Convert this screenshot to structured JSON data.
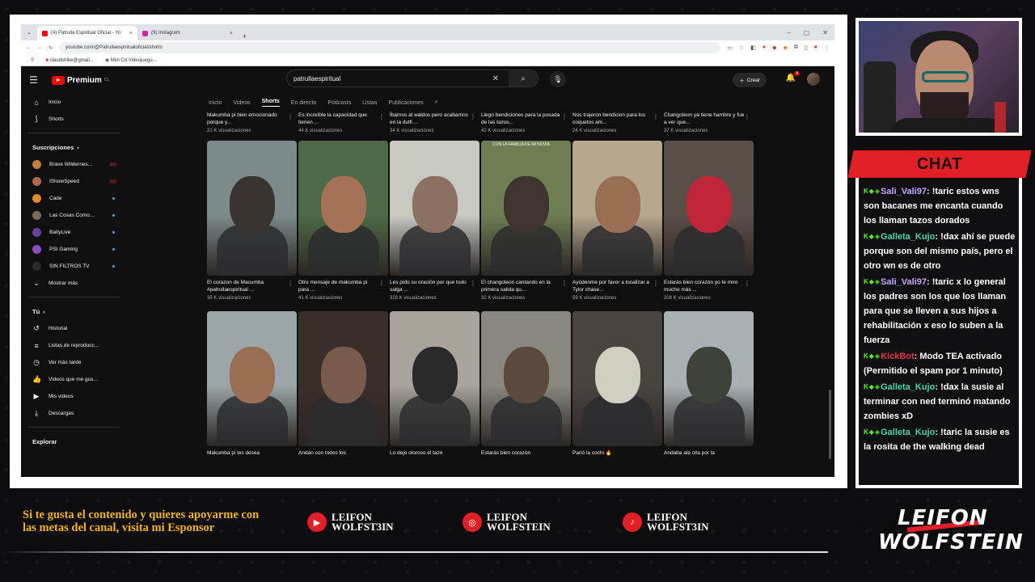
{
  "browser": {
    "tabs": [
      {
        "label": "(4) Patrulla Espiritual Oficial - Yo",
        "favicon_color": "#ff0000"
      },
      {
        "label": "(9) Instagram",
        "favicon_color": "#d6249f"
      }
    ],
    "url": "youtube.com/@Patrullaespiritualoficial/shorts",
    "bookmarks": [
      "claudstrike@gmail...",
      "Mini Cd Videojuego..."
    ]
  },
  "youtube": {
    "logo": "Premium",
    "logo_sup": "CL",
    "search_value": "patrullaespiritual",
    "create_label": "Crear",
    "notif_count": "4",
    "sidebar": {
      "main": [
        {
          "label": "Inicio",
          "icon": "home-icon"
        },
        {
          "label": "Shorts",
          "icon": "shorts-icon"
        }
      ],
      "subs_header": "Suscripciones",
      "subs": [
        {
          "label": "Brave Wildernes...",
          "color": "#c0803a",
          "live": true
        },
        {
          "label": "IShowSpeed",
          "color": "#b5674f",
          "live": true
        },
        {
          "label": "Cade",
          "color": "#e08a2a",
          "dot": true
        },
        {
          "label": "Las Cosas Como...",
          "color": "#7a6a5a",
          "dot": true
        },
        {
          "label": "BaityLive",
          "color": "#6a3f9a",
          "dot": true
        },
        {
          "label": "PSI Gaming",
          "color": "#8a4cc0",
          "dot": true
        },
        {
          "label": "SIN FILTROS TV",
          "color": "#2a2a2a",
          "dot": true
        }
      ],
      "more": "Mostrar más",
      "you_header": "Tú",
      "you": [
        {
          "label": "Historial",
          "icon": "history-icon"
        },
        {
          "label": "Listas de reproducc...",
          "icon": "playlist-icon"
        },
        {
          "label": "Ver más tarde",
          "icon": "clock-icon"
        },
        {
          "label": "Videos que me gus...",
          "icon": "like-icon"
        },
        {
          "label": "Mis videos",
          "icon": "video-icon"
        },
        {
          "label": "Descargas",
          "icon": "download-icon"
        }
      ],
      "explore_header": "Explorar"
    },
    "tabs": [
      "Inicio",
      "Videos",
      "Shorts",
      "En directo",
      "Pódcasts",
      "Listas",
      "Publicaciones"
    ],
    "active_tab": "Shorts",
    "row1": [
      {
        "title": "Makumba pi bien emocionado porque y...",
        "views": "21 K visualizaciones"
      },
      {
        "title": "Es increíble la capacidad que tienen ...",
        "views": "44 K visualizaciones"
      },
      {
        "title": "Íbamos al waldos pero acabamos en la dulfi ...",
        "views": "34 K visualizaciones"
      },
      {
        "title": "Llego bendiciones para la posada de las tazos...",
        "views": "42 K visualizaciones"
      },
      {
        "title": "Nos trajeron bendicion para los coquetos am...",
        "views": "24 K visualizaciones"
      },
      {
        "title": "Changoleon ya tiene hambre y fue a ver que...",
        "views": "37 K visualizaciones"
      }
    ],
    "row2": [
      {
        "title": "El corazon de Macumba #patrullaespiritual ...",
        "views": "35 K visualizaciones",
        "bg": "#7d8a8c",
        "fg": "#3a3430"
      },
      {
        "title": "Otro mensaje de makumba pi para ...",
        "views": "41 K visualizaciones",
        "bg": "#4e6a46",
        "fg": "#a57258"
      },
      {
        "title": "Les pido su oración por que todo salga ...",
        "views": "328 K visualizaciones",
        "bg": "#c9c9c4",
        "fg": "#8c7060"
      },
      {
        "title": "El changoleon cantando en la primera salida qu...",
        "views": "32 K visualizaciones",
        "bg": "#6e7d52",
        "fg": "#3f3530"
      },
      {
        "title": "Ayúdenme por favor a localizar a Tylor chase...",
        "views": "59 K visualizaciones",
        "bg": "#b7a78f",
        "fg": "#9a6e55"
      },
      {
        "title": "Estarás bien corazón yo te miro mucho más ...",
        "views": "208 K visualizaciones",
        "bg": "#5a4e48",
        "fg": "#c0263a"
      }
    ],
    "overlay_text": "CON LA FAMILIA DE MI NOVIA",
    "row3": [
      {
        "title": "Makumba pi les desea",
        "bg": "#9aa6a8",
        "fg": "#9a6e55"
      },
      {
        "title": "Andan con todos los",
        "bg": "#3a2e2a",
        "fg": "#7a5a4a"
      },
      {
        "title": "Lo dejo oloroso el tazo",
        "bg": "#a8a49c",
        "fg": "#2a2a2a"
      },
      {
        "title": "Estarás bien corazón",
        "bg": "#8a8680",
        "fg": "#5a4a40"
      },
      {
        "title": "Parió la cochi 🔥",
        "bg": "#4a4440",
        "fg": "#d0cec0"
      },
      {
        "title": "Andaba ala cita por la",
        "bg": "#a9b0b4",
        "fg": "#3e4238"
      }
    ]
  },
  "chat": {
    "title": "CHAT",
    "messages": [
      {
        "user": "Sali_Vali97",
        "color": "#c7a4ff",
        "text": ": !taric estos wns son bacanes me encanta cuando los llaman tazos dorados"
      },
      {
        "user": "Galleta_Kujo",
        "color": "#4fd6a8",
        "text": ": !dax ahí se puede porque son del mismo país, pero el otro wn es de otro"
      },
      {
        "user": "Sali_Vali97",
        "color": "#c7a4ff",
        "text": ": !taric x lo general los padres son los que los llaman para que se lleven a sus hijos a rehabilitación x eso lo suben a la fuerza"
      },
      {
        "user": "KickBot",
        "color": "#e0384a",
        "text": ": Modo TEA activado (Permitido el spam por 1 minuto)"
      },
      {
        "user": "Galleta_Kujo",
        "color": "#4fd6a8",
        "text": ": !dax la susie al terminar con ned terminó matando zombies xD"
      },
      {
        "user": "Galleta_Kujo",
        "color": "#4fd6a8",
        "text": ": !taric la susie es la rosita de the walking dead"
      }
    ]
  },
  "overlay": {
    "promo": "Si te gusta el contenido y quieres apoyarme con las metas del canal, visita mi Esponsor",
    "socials": [
      {
        "icon": "youtube-icon",
        "line1": "LEIFON",
        "line2": "WOLFST3IN"
      },
      {
        "icon": "instagram-icon",
        "line1": "LEIFON",
        "line2": "WOLFSTEIN"
      },
      {
        "icon": "tiktok-icon",
        "line1": "LEIFON",
        "line2": "WOLFST3IN"
      }
    ],
    "brand_l1": "LEIFON",
    "brand_l2": "WOLFSTEIN",
    "accent": "#e21f26",
    "promo_color": "#f0b428"
  }
}
